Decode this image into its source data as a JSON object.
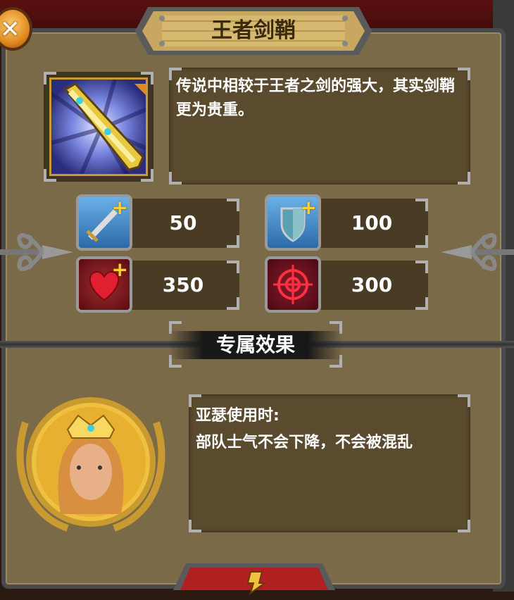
{
  "title": "王者剑鞘",
  "description": "传说中相较于王者之剑的强大，其实剑鞘更为贵重。",
  "stats": [
    {
      "icon": "sword-attack-icon",
      "value": "50"
    },
    {
      "icon": "shield-defense-icon",
      "value": "100"
    },
    {
      "icon": "heart-health-icon",
      "value": "350"
    },
    {
      "icon": "crosshair-target-icon",
      "value": "300"
    }
  ],
  "section_title": "专属效果",
  "effect": {
    "line1": "亚瑟使用时:",
    "line2": "部队士气不会下降，不会被混乱"
  },
  "colors": {
    "panel": "#7b6a48",
    "box": "#5a4a2e",
    "title_plate": "#c8a860",
    "accent_gold": "#ffd030"
  }
}
